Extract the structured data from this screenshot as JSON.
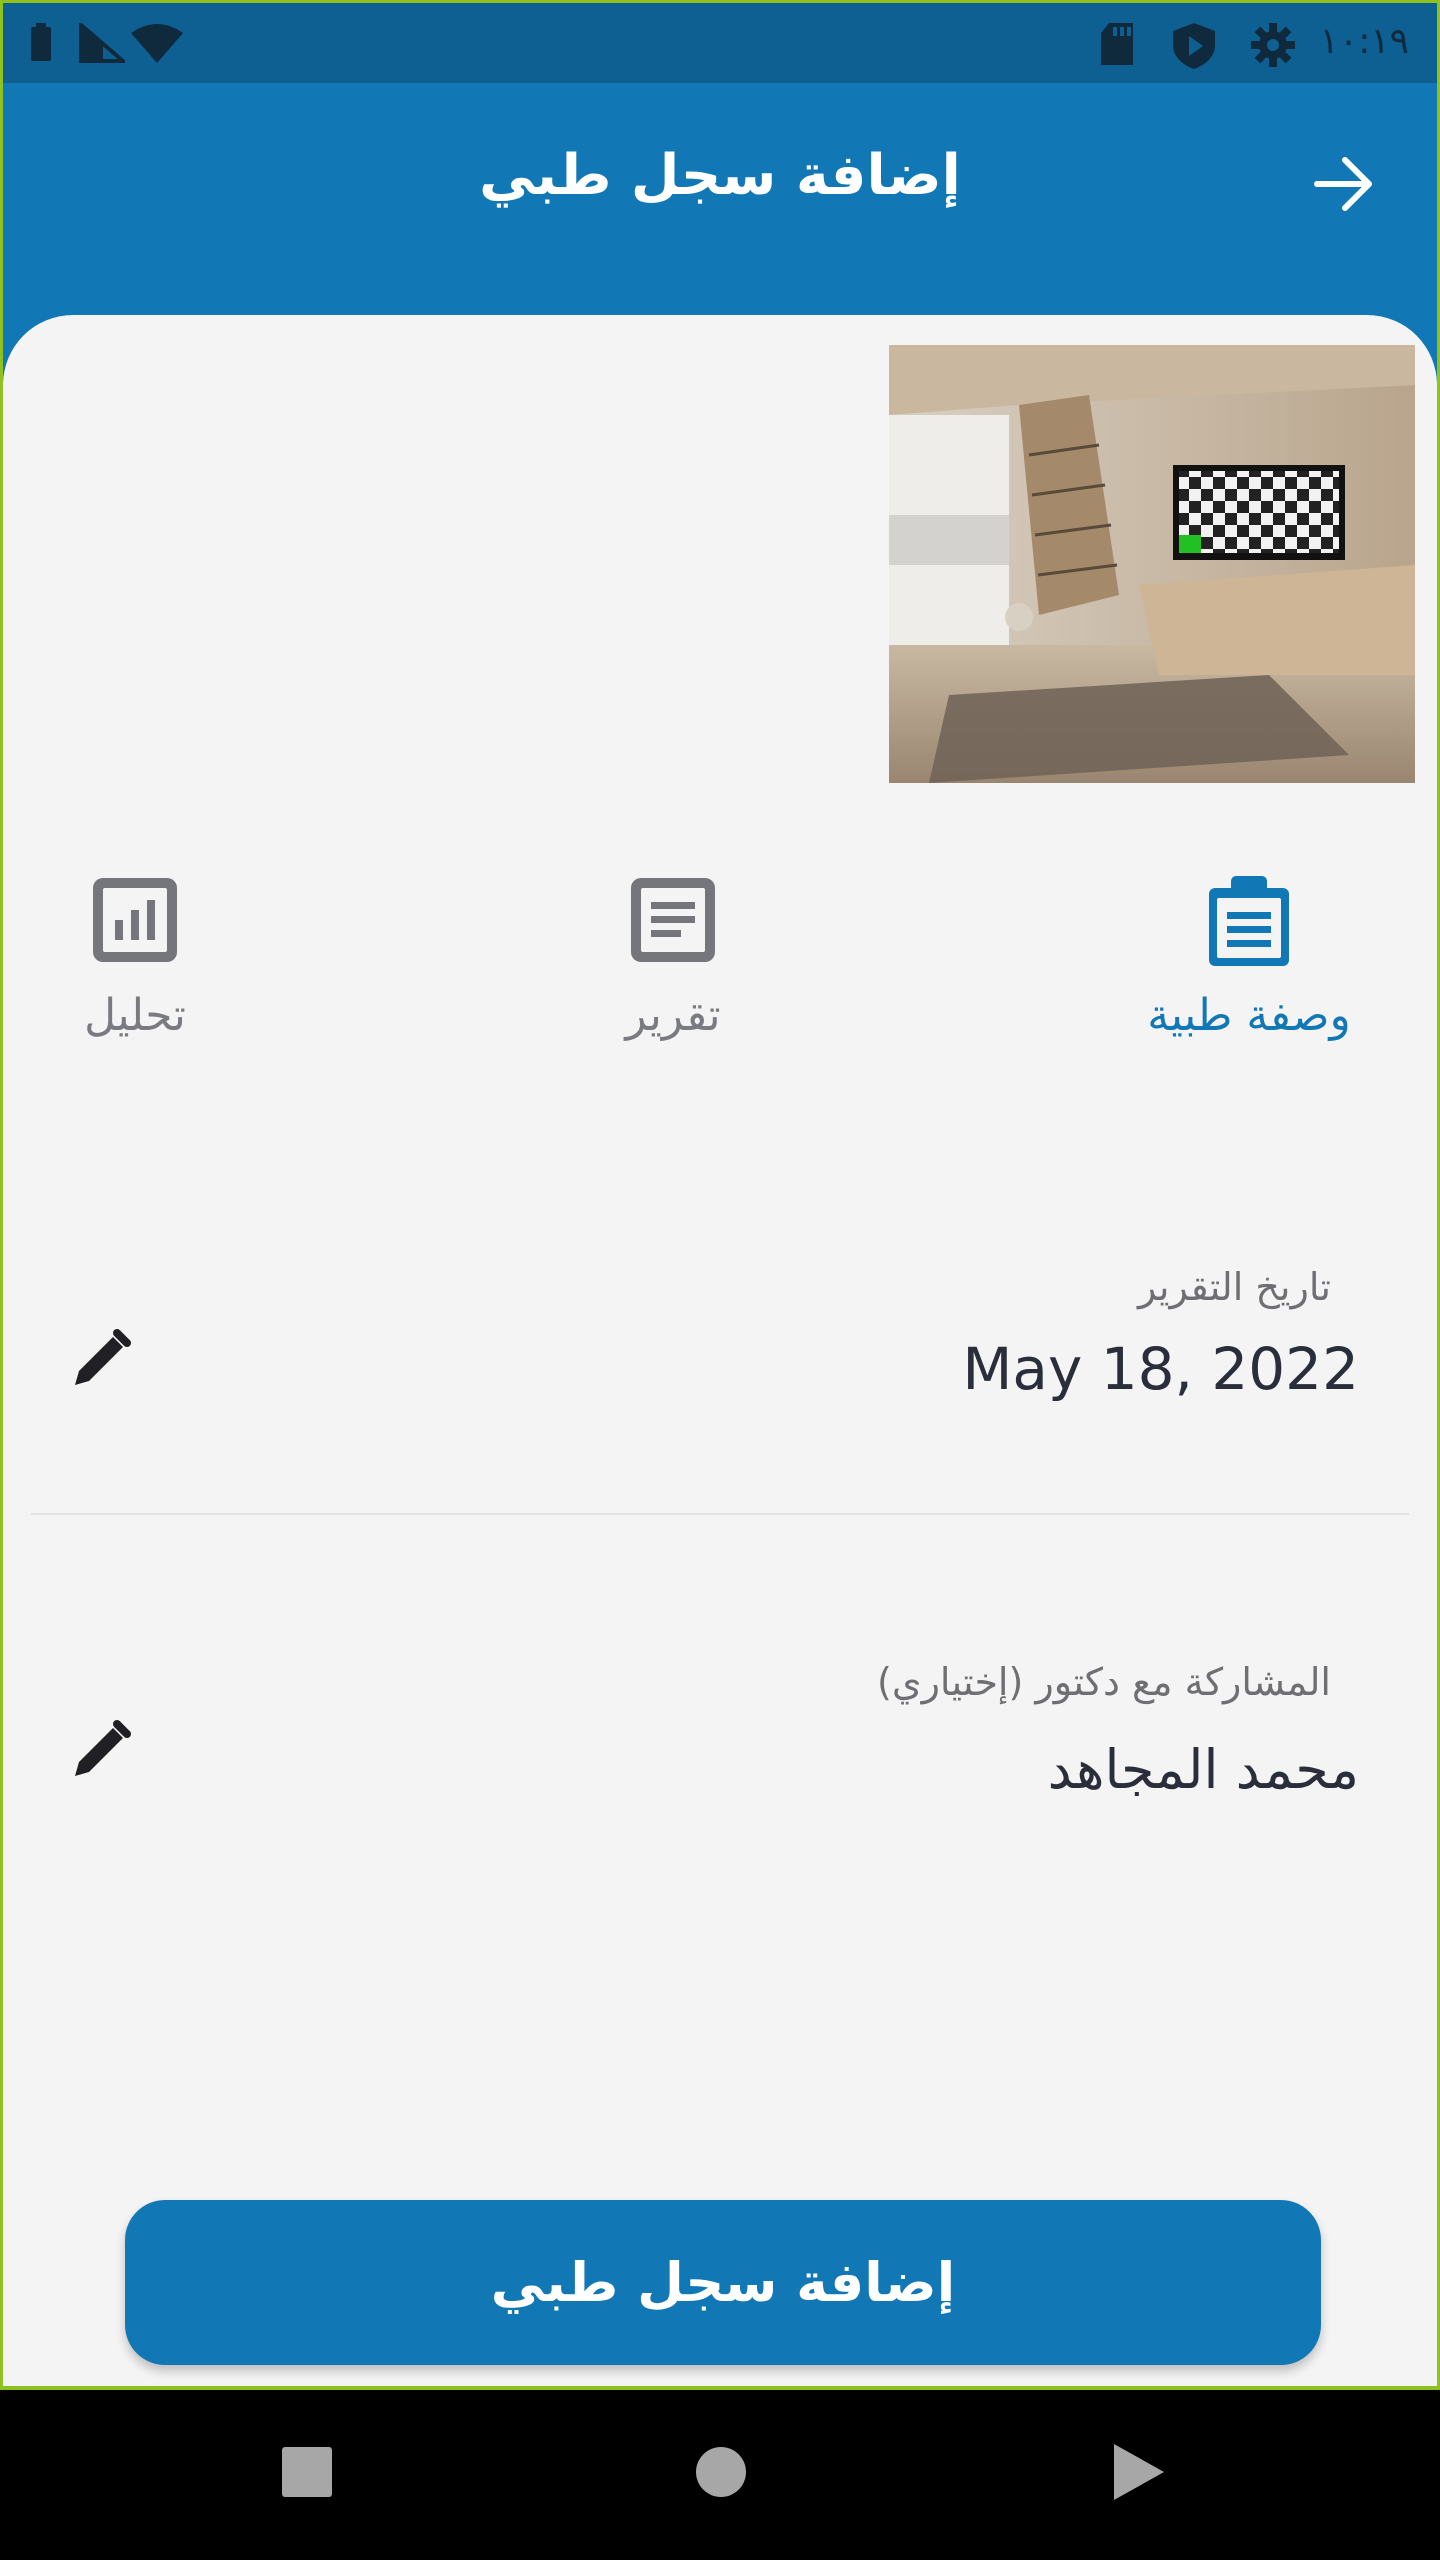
{
  "status_bar": {
    "time": "١٠:١٩",
    "icons": [
      "battery-icon",
      "signal-icon",
      "wifi-icon",
      "sd-card-icon",
      "shield-play-icon",
      "settings-gear-icon"
    ]
  },
  "header": {
    "title": "إضافة سجل طبي",
    "back_icon": "arrow-right-icon"
  },
  "tabs": [
    {
      "label": "وصفة طبية",
      "icon": "clipboard-list-icon",
      "active": true
    },
    {
      "label": "تقرير",
      "icon": "document-icon",
      "active": false
    },
    {
      "label": "تحليل",
      "icon": "bar-chart-icon",
      "active": false
    }
  ],
  "fields": {
    "report_date": {
      "label": "تاريخ التقرير",
      "value": "May 18, 2022"
    },
    "share_doctor": {
      "label": "المشاركة مع دكتور (إختياري)",
      "value": "محمد المجاهد"
    }
  },
  "submit_button": {
    "label": "إضافة سجل طبي"
  },
  "colors": {
    "primary": "#1278b5",
    "status_bar": "#0e5f92",
    "sheet_background": "#f4f4f5",
    "inactive": "#7a7b80"
  },
  "nav_bar": {
    "buttons": [
      "recent-apps-square-icon",
      "home-circle-icon",
      "back-triangle-icon"
    ]
  }
}
